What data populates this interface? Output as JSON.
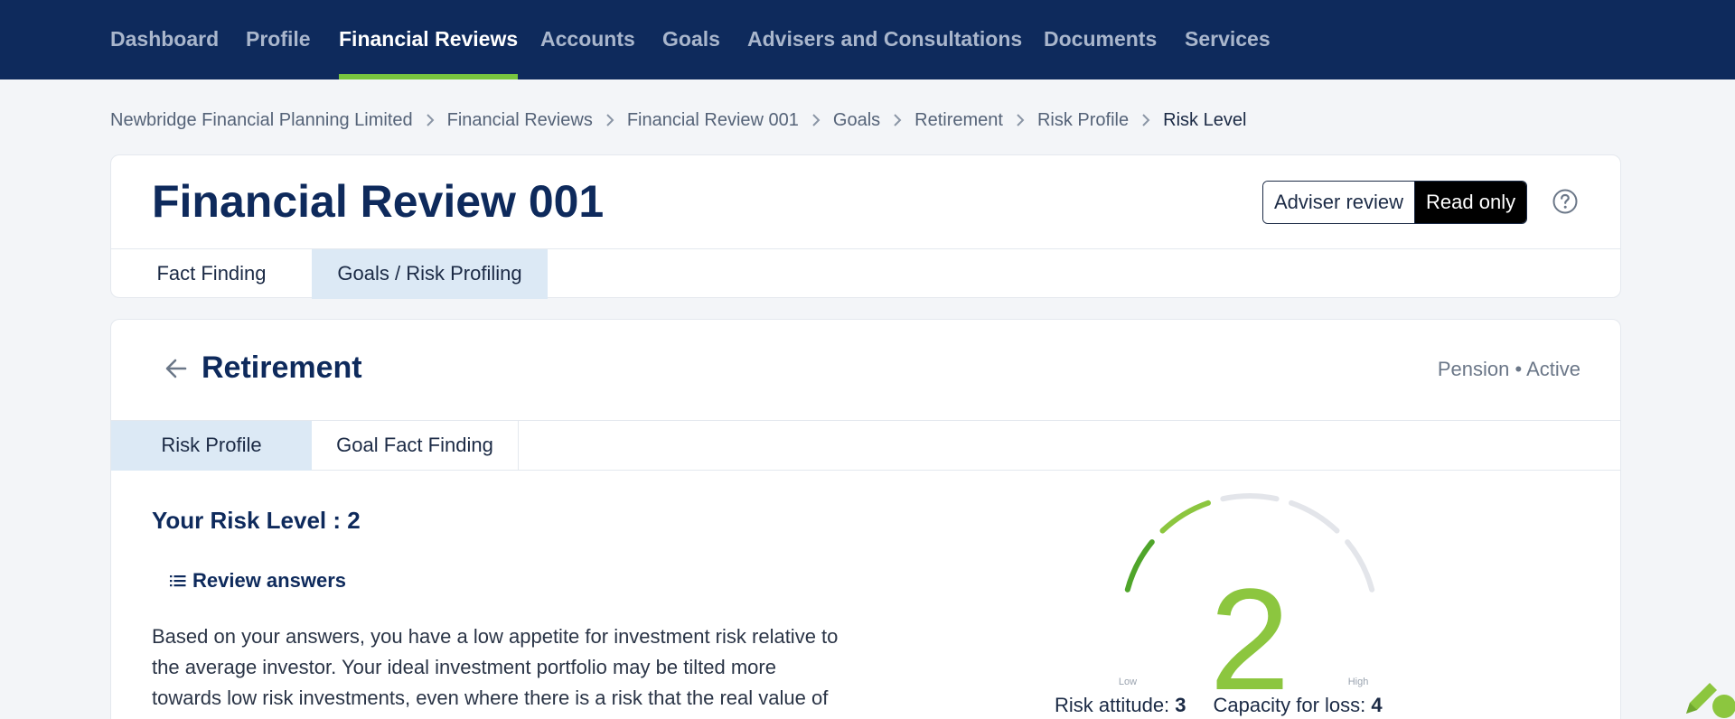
{
  "nav": {
    "items": [
      {
        "label": "Dashboard"
      },
      {
        "label": "Profile"
      },
      {
        "label": "Financial Reviews",
        "active": true
      },
      {
        "label": "Accounts"
      },
      {
        "label": "Goals"
      },
      {
        "label": "Advisers and Consultations"
      },
      {
        "label": "Documents"
      },
      {
        "label": "Services"
      }
    ]
  },
  "breadcrumb": [
    "Newbridge Financial Planning Limited",
    "Financial Reviews",
    "Financial Review 001",
    "Goals",
    "Retirement",
    "Risk Profile",
    "Risk Level"
  ],
  "header": {
    "title": "Financial Review 001",
    "mode_options": [
      "Adviser review",
      "Read only"
    ],
    "mode_selected": "Read only",
    "tabs": [
      {
        "label": "Fact Finding"
      },
      {
        "label": "Goals / Risk Profiling",
        "active": true
      }
    ]
  },
  "section": {
    "title": "Retirement",
    "meta": "Pension • Active",
    "tabs": [
      {
        "label": "Risk Profile",
        "active": true
      },
      {
        "label": "Goal Fact Finding"
      }
    ]
  },
  "risk": {
    "heading": "Your Risk Level : 2",
    "review_link": "Review answers",
    "description": "Based on your answers, you have a low appetite for investment risk relative to the average investor. Your ideal investment portfolio may be tilted more towards low risk investments, even where there is a risk that the real value of your money may be reduced by inflation. While",
    "gauge": {
      "level": "2",
      "level_value": 2,
      "max_level": 5,
      "low_label": "Low",
      "high_label": "High"
    },
    "attitude_label": "Risk attitude:",
    "attitude_value": "3",
    "capacity_label": "Capacity for loss:",
    "capacity_value": "4"
  },
  "colors": {
    "nav_bg": "#0e2a5c",
    "nav_active_underline": "#78c53f",
    "tab_active_bg": "#dce9f5",
    "gauge_green": "#8cc63f",
    "gauge_dark_green": "#4fa52a",
    "gauge_track": "#e3e5ea"
  }
}
